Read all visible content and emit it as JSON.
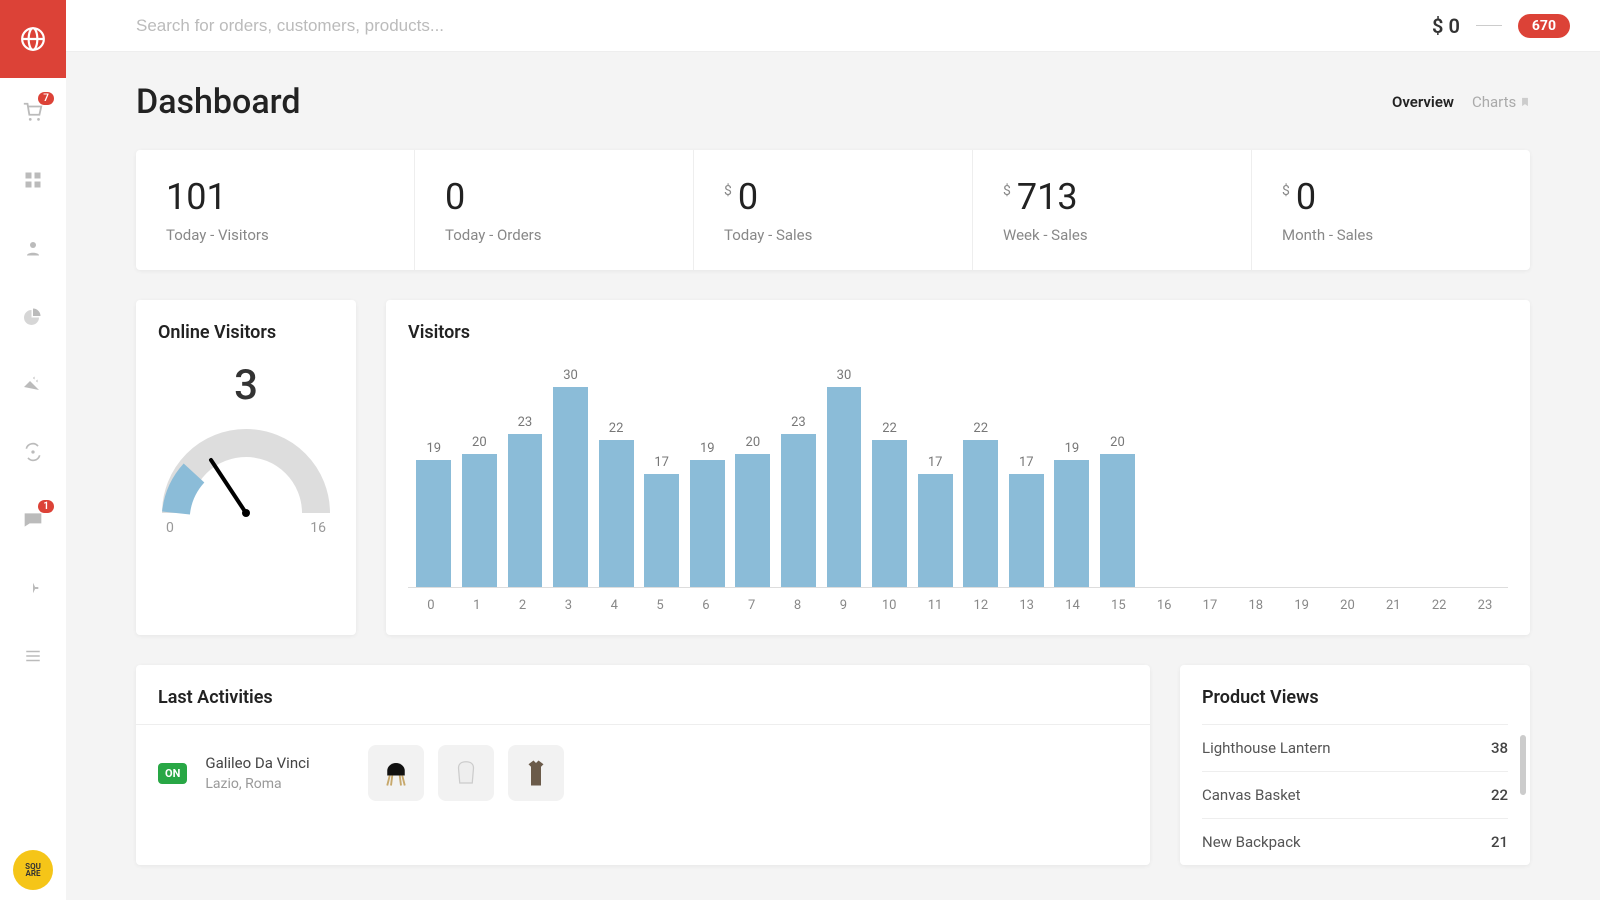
{
  "search": {
    "placeholder": "Search for orders, customers, products..."
  },
  "topbar": {
    "price_prefix": "$",
    "price": "0",
    "pill": "670"
  },
  "sidebar": {
    "badges": {
      "cart": "7",
      "chat": "1"
    },
    "bottom_label": "SQU\nARE"
  },
  "page": {
    "title": "Dashboard"
  },
  "tabs": {
    "overview": "Overview",
    "charts": "Charts"
  },
  "stats": [
    {
      "value": "101",
      "label": "Today - Visitors",
      "dollar": false
    },
    {
      "value": "0",
      "label": "Today - Orders",
      "dollar": false
    },
    {
      "value": "0",
      "label": "Today - Sales",
      "dollar": true
    },
    {
      "value": "713",
      "label": "Week - Sales",
      "dollar": true
    },
    {
      "value": "0",
      "label": "Month - Sales",
      "dollar": true
    }
  ],
  "gauge": {
    "title": "Online Visitors",
    "value": "3",
    "min": "0",
    "max": "16"
  },
  "visitors": {
    "title": "Visitors"
  },
  "chart_data": {
    "type": "bar",
    "title": "Visitors",
    "xlabel": "",
    "ylabel": "",
    "categories": [
      "0",
      "1",
      "2",
      "3",
      "4",
      "5",
      "6",
      "7",
      "8",
      "9",
      "10",
      "11",
      "12",
      "13",
      "14",
      "15",
      "16",
      "17",
      "18",
      "19",
      "20",
      "21",
      "22",
      "23"
    ],
    "values": [
      19,
      20,
      23,
      30,
      22,
      17,
      19,
      20,
      23,
      30,
      22,
      17,
      22,
      17,
      19,
      20,
      null,
      null,
      null,
      null,
      null,
      null,
      null,
      null
    ],
    "ylim": [
      0,
      30
    ]
  },
  "activities": {
    "title": "Last Activities",
    "rows": [
      {
        "badge": "ON",
        "name": "Galileo Da Vinci",
        "location": "Lazio, Roma"
      }
    ]
  },
  "product_views": {
    "title": "Product Views",
    "items": [
      {
        "name": "Lighthouse Lantern",
        "count": "38"
      },
      {
        "name": "Canvas Basket",
        "count": "22"
      },
      {
        "name": "New Backpack",
        "count": "21"
      }
    ]
  }
}
